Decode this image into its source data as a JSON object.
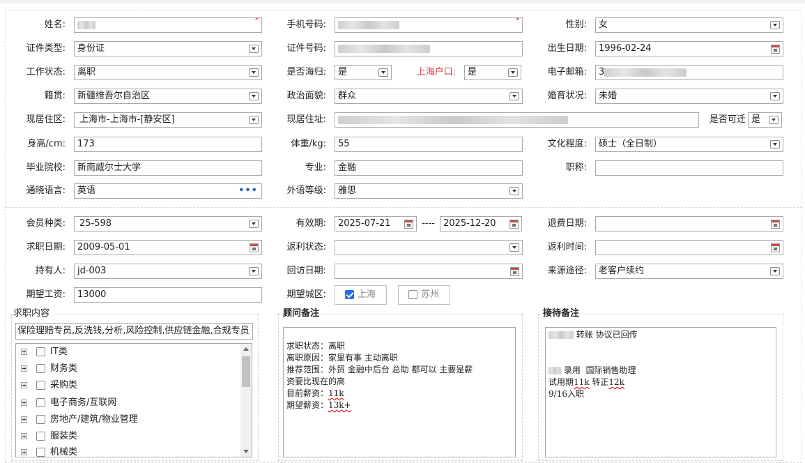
{
  "personal": {
    "name": {
      "label": "姓名:",
      "required": "*"
    },
    "phone": {
      "label": "手机号码:",
      "required": "*"
    },
    "gender": {
      "label": "性别:",
      "value": "女"
    },
    "id_type": {
      "label": "证件类型:",
      "value": "身份证"
    },
    "id_number": {
      "label": "证件号码:"
    },
    "birth_date": {
      "label": "出生日期:",
      "value": "1996-02-24"
    },
    "work_status": {
      "label": "工作状态:",
      "value": "离职"
    },
    "returnee": {
      "label": "是否海归:",
      "value": "是"
    },
    "shanghai_hukou": {
      "label": "上海户口:",
      "value": "是"
    },
    "email": {
      "label": "电子邮箱:",
      "value": "3"
    },
    "native_place": {
      "label": "籍贯:",
      "value": "新疆维吾尔自治区"
    },
    "political": {
      "label": "政治面貌:",
      "value": "群众"
    },
    "marital": {
      "label": "婚育状况:",
      "value": "未婚"
    },
    "residence_area": {
      "label": "现居住区:",
      "value": "上海市-上海市-[静安区]"
    },
    "residence_address": {
      "label": "现居住址:"
    },
    "relocate": {
      "label": "是否可迁",
      "value": "是"
    },
    "height": {
      "label": "身高/cm:",
      "value": "173"
    },
    "weight": {
      "label": "体重/kg:",
      "value": "55"
    },
    "education": {
      "label": "文化程度:",
      "value": "硕士（全日制）"
    },
    "school": {
      "label": "毕业院校:",
      "value": "新南威尔士大学"
    },
    "major": {
      "label": "专业:",
      "value": "金融"
    },
    "title": {
      "label": "职称:",
      "value": ""
    },
    "language": {
      "label": "通晓语言:",
      "value": "英语",
      "more": "•••"
    },
    "foreign_level": {
      "label": "外语等级:",
      "value": "雅思"
    }
  },
  "membership": {
    "member_type": {
      "label": "会员种类:",
      "value": "25-598"
    },
    "valid_period": {
      "label": "有效期:",
      "start": "2025-07-21",
      "sep": "----",
      "end": "2025-12-20"
    },
    "refund_date": {
      "label": "退费日期:",
      "value": ""
    },
    "job_date": {
      "label": "求职日期:",
      "value": "2009-05-01"
    },
    "rebate_status": {
      "label": "返利状态:",
      "value": ""
    },
    "rebate_time": {
      "label": "返利时间:",
      "value": ""
    },
    "holder": {
      "label": "持有人:",
      "value": "jd-003"
    },
    "revisit_date": {
      "label": "回访日期:",
      "value": ""
    },
    "source": {
      "label": "来源途径:",
      "value": "老客户续约"
    },
    "expected_salary": {
      "label": "期望工资:",
      "value": "13000"
    },
    "expected_city": {
      "label": "期望城区:",
      "options": [
        {
          "label": "上海",
          "checked": true
        },
        {
          "label": "苏州",
          "checked": false
        }
      ]
    }
  },
  "job_content": {
    "title": "求职内容",
    "summary": "保险理赔专员,反洗钱,分析,风险控制,供应链金融,合规专员",
    "tree": [
      "IT类",
      "财务类",
      "采购类",
      "电子商务/互联网",
      "房地产/建筑/物业管理",
      "服装类",
      "机械类"
    ]
  },
  "consultant_notes": {
    "title": "顾问备注",
    "lines": [
      "求职状态：离职",
      "离职原因：家里有事 主动离职",
      "推荐范围：外贸 金融中后台 总助 都可以 主要是薪",
      "资要比现在的高"
    ],
    "current_label": "目前薪资：",
    "current_value": "11k",
    "expected_label": "期望薪资：",
    "expected_value": "13k+"
  },
  "reception_notes": {
    "title": "接待备注",
    "line1": " 转账 协议已回传",
    "line2": " 录用  国际销售助理",
    "line3_pre": "试用期",
    "line3_a": "11k",
    "line3_mid": " 转正",
    "line3_b": "12k",
    "line4": "9/16入职"
  }
}
